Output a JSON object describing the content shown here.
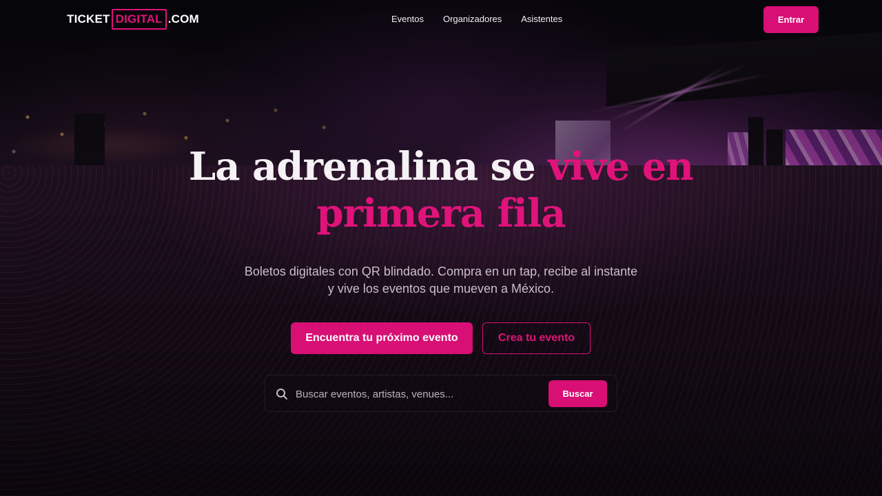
{
  "header": {
    "logo": {
      "prefix": "TICKET",
      "boxed": "DIGITAL",
      "suffix": ".COM"
    },
    "nav": [
      "Eventos",
      "Organizadores",
      "Asistentes"
    ],
    "enter_label": "Entrar"
  },
  "hero": {
    "title_line1_white": "La adrenalina se ",
    "title_line1_pink": "vive en",
    "title_line2_pink": "primera fila",
    "subtitle_line1": "Boletos digitales con QR blindado. Compra en un tap, recibe al instante",
    "subtitle_line2": "y vive los eventos que mueven a México.",
    "cta_primary": "Encuentra tu próximo evento",
    "cta_secondary": "Crea tu evento"
  },
  "search": {
    "placeholder": "Buscar eventos, artistas, venues...",
    "button_label": "Buscar",
    "icon": "search-icon"
  },
  "colors": {
    "accent": "#d80f74",
    "accent_text": "#e0137a"
  }
}
